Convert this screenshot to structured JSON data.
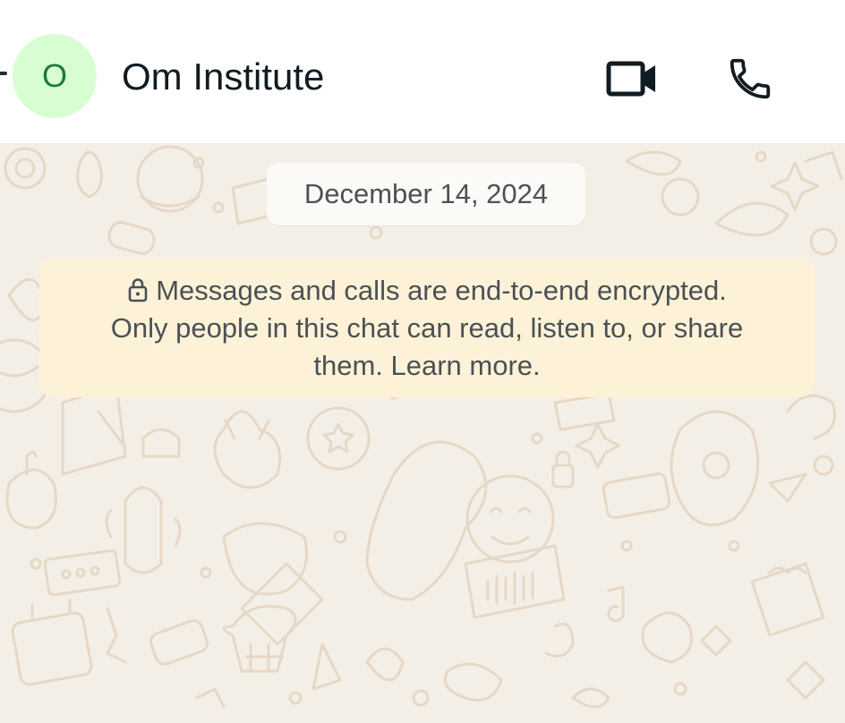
{
  "header": {
    "avatar_letter": "O",
    "contact_name": "Om Institute",
    "icons": {
      "back": "back-arrow-icon",
      "video": "video-camera-icon",
      "call": "phone-icon"
    },
    "avatar_bg": "#d9fdd3",
    "avatar_fg": "#1e7a3a"
  },
  "chat": {
    "date_label": "December 14, 2024",
    "encryption_notice": {
      "line1": "Messages and calls are end-to-end encrypted.",
      "line2": "Only people in this chat can read, listen to, or share",
      "line3": "them. Learn more.",
      "icon": "lock-icon"
    },
    "wallpaper_color": "#f4efe6",
    "notice_color": "#fdf2d7"
  }
}
